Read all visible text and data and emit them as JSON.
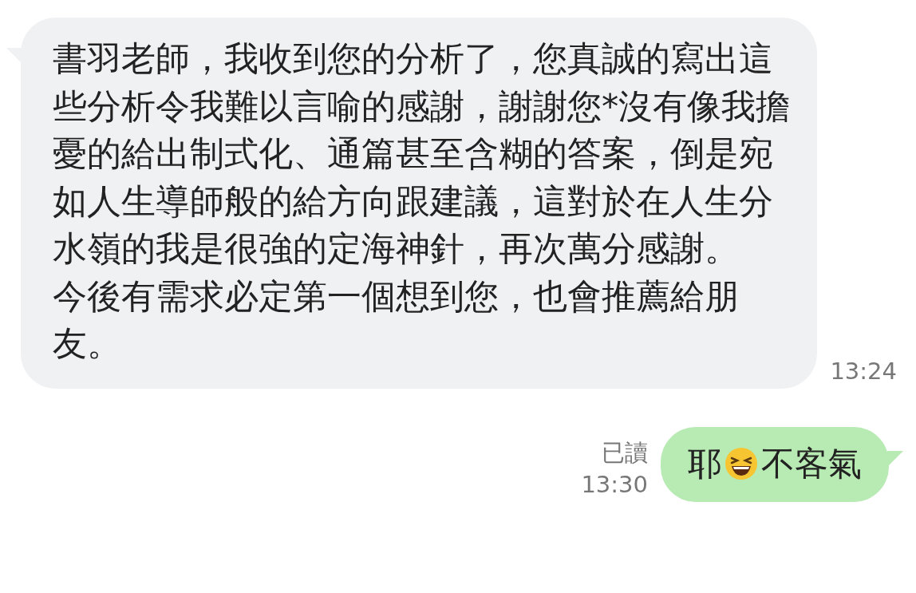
{
  "messages": [
    {
      "kind": "received",
      "paragraphs": [
        "書羽老師，我收到您的分析了，您真誠的寫出這些分析令我難以言喻的感謝，謝謝您*沒有像我擔憂的給出制式化、通篇甚至含糊的答案，倒是宛如人生導師般的給方向跟建議，這對於在人生分水嶺的我是很強的定海神針，再次萬分感謝。",
        "今後有需求必定第一個想到您，也會推薦給朋友。"
      ],
      "time": "13:24"
    },
    {
      "kind": "sent",
      "text_before": "耶",
      "text_after": "不客氣",
      "read_label": "已讀",
      "time": "13:30"
    }
  ]
}
